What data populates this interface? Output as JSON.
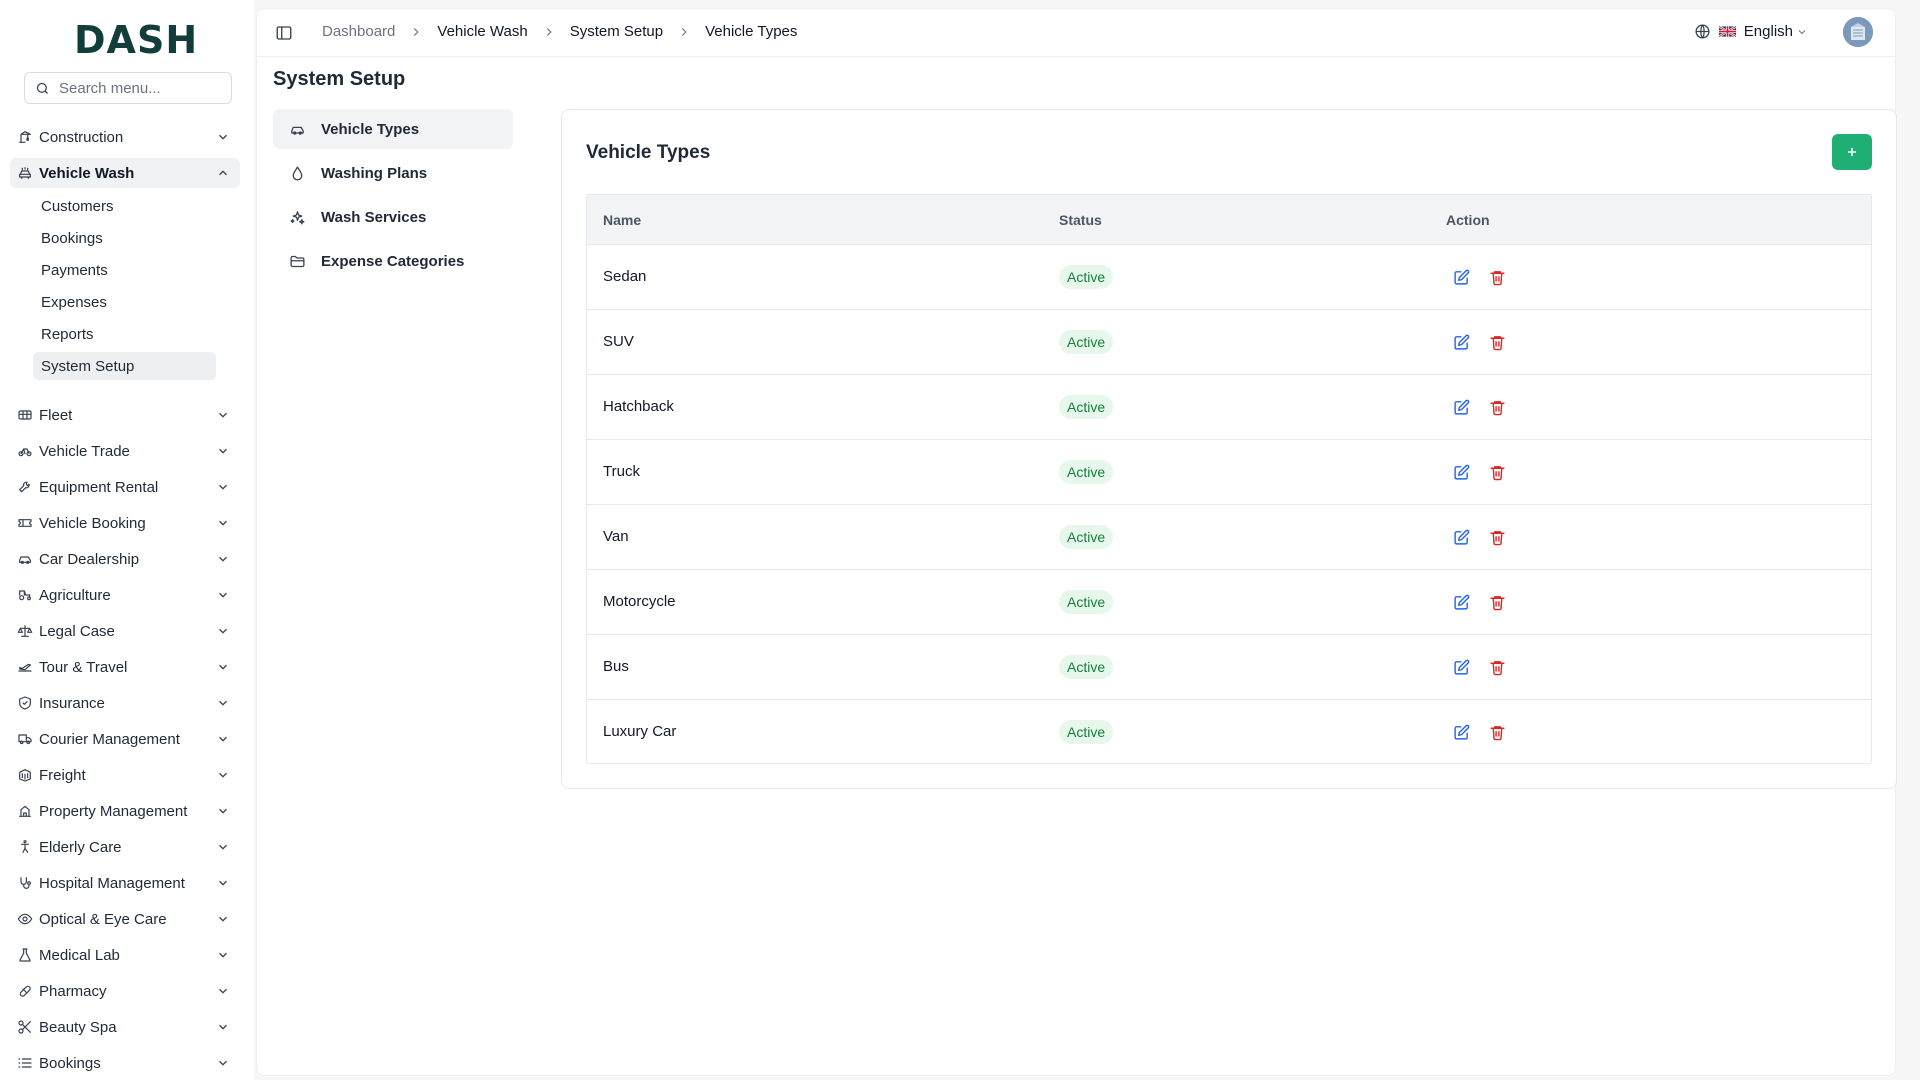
{
  "brand": {
    "logo": "DASH"
  },
  "search": {
    "placeholder": "Search menu..."
  },
  "sidebar": {
    "items": [
      {
        "label": "Construction",
        "icon": "crane-icon",
        "open": false
      },
      {
        "label": "Vehicle Wash",
        "icon": "car-wash-icon",
        "open": true
      },
      {
        "label": "Fleet",
        "icon": "fleet-icon",
        "open": false
      },
      {
        "label": "Vehicle Trade",
        "icon": "bike-icon",
        "open": false
      },
      {
        "label": "Equipment Rental",
        "icon": "wrench-icon",
        "open": false
      },
      {
        "label": "Vehicle Booking",
        "icon": "ticket-icon",
        "open": false
      },
      {
        "label": "Car Dealership",
        "icon": "car-icon",
        "open": false
      },
      {
        "label": "Agriculture",
        "icon": "tractor-icon",
        "open": false
      },
      {
        "label": "Legal Case",
        "icon": "scale-icon",
        "open": false
      },
      {
        "label": "Tour & Travel",
        "icon": "plane-icon",
        "open": false
      },
      {
        "label": "Insurance",
        "icon": "shield-icon",
        "open": false
      },
      {
        "label": "Courier Management",
        "icon": "truck-icon",
        "open": false
      },
      {
        "label": "Freight",
        "icon": "container-icon",
        "open": false
      },
      {
        "label": "Property Management",
        "icon": "building-icon",
        "open": false
      },
      {
        "label": "Elderly Care",
        "icon": "accessibility-icon",
        "open": false
      },
      {
        "label": "Hospital Management",
        "icon": "stethoscope-icon",
        "open": false
      },
      {
        "label": "Optical & Eye Care",
        "icon": "eye-icon",
        "open": false
      },
      {
        "label": "Medical Lab",
        "icon": "flask-icon",
        "open": false
      },
      {
        "label": "Pharmacy",
        "icon": "pill-icon",
        "open": false
      },
      {
        "label": "Beauty Spa",
        "icon": "scissors-icon",
        "open": false
      },
      {
        "label": "Bookings",
        "icon": "list-icon",
        "open": false
      }
    ],
    "sub_items": [
      "Customers",
      "Bookings",
      "Payments",
      "Expenses",
      "Reports",
      "System Setup"
    ],
    "active_sub": "System Setup"
  },
  "breadcrumb": [
    "Dashboard",
    "Vehicle Wash",
    "System Setup",
    "Vehicle Types"
  ],
  "header": {
    "language": "English"
  },
  "page": {
    "title": "System Setup"
  },
  "setup_nav": [
    {
      "label": "Vehicle Types",
      "icon": "car-icon",
      "active": true
    },
    {
      "label": "Washing Plans",
      "icon": "droplet-icon",
      "active": false
    },
    {
      "label": "Wash Services",
      "icon": "sparkles-icon",
      "active": false
    },
    {
      "label": "Expense Categories",
      "icon": "folder-icon",
      "active": false
    }
  ],
  "card": {
    "title": "Vehicle Types",
    "add_label": "+"
  },
  "table": {
    "columns": [
      "Name",
      "Status",
      "Action"
    ],
    "rows": [
      {
        "name": "Sedan",
        "status": "Active"
      },
      {
        "name": "SUV",
        "status": "Active"
      },
      {
        "name": "Hatchback",
        "status": "Active"
      },
      {
        "name": "Truck",
        "status": "Active"
      },
      {
        "name": "Van",
        "status": "Active"
      },
      {
        "name": "Motorcycle",
        "status": "Active"
      },
      {
        "name": "Bus",
        "status": "Active"
      },
      {
        "name": "Luxury Car",
        "status": "Active"
      }
    ]
  },
  "colors": {
    "accent": "#1fae74",
    "badge_bg": "#e7f7ec",
    "badge_text": "#15803d",
    "edit": "#2563eb",
    "delete": "#dc2626"
  }
}
